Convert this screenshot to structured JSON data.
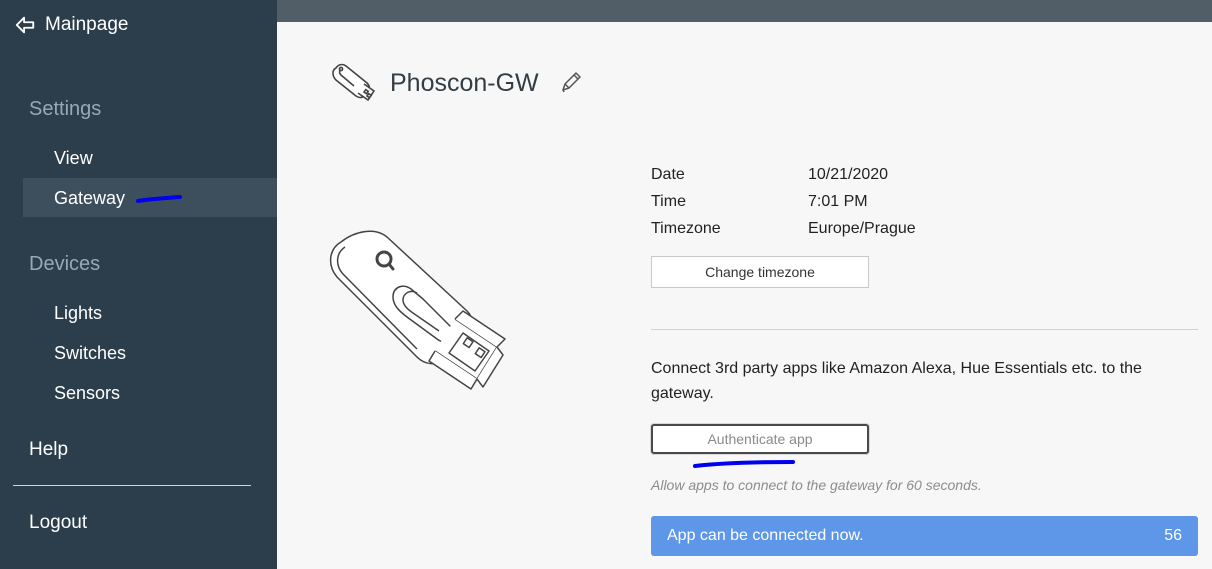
{
  "sidebar": {
    "back_label": "Mainpage",
    "settings_heading": "Settings",
    "settings_items": [
      "View",
      "Gateway"
    ],
    "devices_heading": "Devices",
    "devices_items": [
      "Lights",
      "Switches",
      "Sensors"
    ],
    "help_label": "Help",
    "logout_label": "Logout",
    "active_item": "Gateway"
  },
  "gateway": {
    "name": "Phoscon-GW",
    "info": [
      {
        "key": "Date",
        "value": "10/21/2020"
      },
      {
        "key": "Time",
        "value": "7:01 PM"
      },
      {
        "key": "Timezone",
        "value": "Europe/Prague"
      }
    ],
    "change_timezone_label": "Change timezone",
    "connect_text": "Connect 3rd party apps like Amazon Alexa, Hue Essentials etc. to the gateway.",
    "authenticate_label": "Authenticate app",
    "hint": "Allow apps to connect to the gateway for 60 seconds.",
    "status_text": "App can be connected now.",
    "countdown": "56"
  },
  "colors": {
    "sidebar_bg": "#2c3e4c",
    "topbar_bg": "#525e67",
    "status_bar_bg": "#5e96e8",
    "annotation_marks": "#0000ee"
  },
  "icons": {
    "back": "arrow-left-icon",
    "gateway_small": "usb-stick-icon",
    "edit": "pencil-icon",
    "gateway_large": "usb-stick-illustration"
  }
}
